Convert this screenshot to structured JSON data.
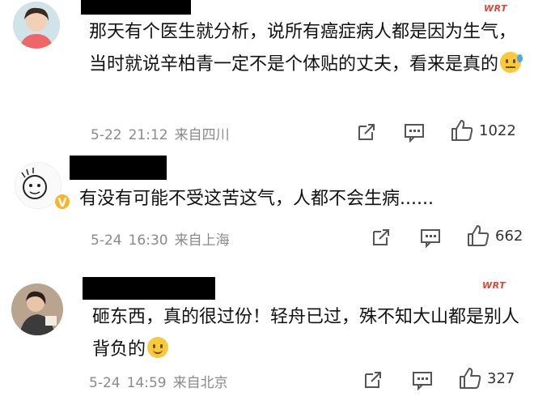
{
  "comments": [
    {
      "text": "那天有个医生就分析，说所有癌症病人都是因为生气，当时就说辛柏青一定不是个体贴的丈夫，看来是真的",
      "emoji": "sweat-emoji",
      "date": "5-22",
      "time": "21:12",
      "location": "来自四川",
      "likes": "1022",
      "watermark": "WRT"
    },
    {
      "text": "有没有可能不受这苦这气，人都不会生病......",
      "date": "5-24",
      "time": "16:30",
      "location": "来自上海",
      "likes": "662",
      "badge": "V"
    },
    {
      "text": "砸东西，真的很过份！轻舟已过，殊不知大山都是别人背负的",
      "emoji": "smile-emoji",
      "date": "5-24",
      "time": "14:59",
      "location": "来自北京",
      "likes": "327",
      "watermark": "WRT"
    }
  ],
  "icons": {
    "share": "share-icon",
    "comment": "comment-icon",
    "like": "thumbs-up-icon"
  },
  "colors": {
    "meta": "#8a8a8a",
    "watermark": "#e0453a",
    "badge": "#f7b52c"
  }
}
